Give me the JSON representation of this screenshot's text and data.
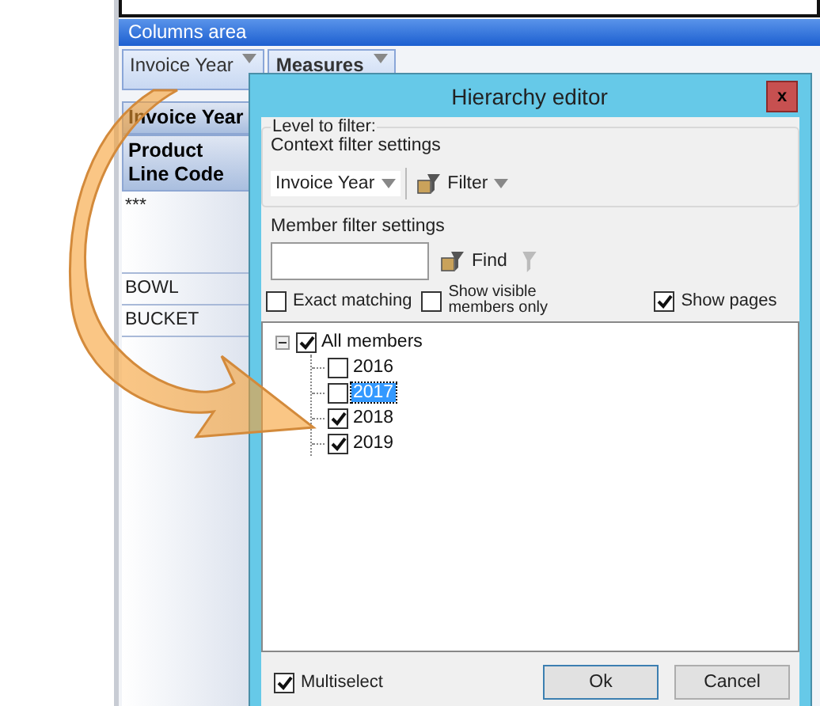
{
  "pivot": {
    "columns_area": {
      "title": "Columns area",
      "fields": [
        {
          "label": "Invoice Year"
        },
        {
          "label": "Measures"
        }
      ]
    },
    "row_headers": [
      "Invoice Year",
      "Product Line Code"
    ],
    "rows": [
      {
        "label": "***"
      },
      {
        "label": "BOWL"
      },
      {
        "label": "BUCKET"
      }
    ]
  },
  "dialog": {
    "title": "Hierarchy editor",
    "close": "x",
    "level_group": "Level to filter:",
    "context_label": "Context filter settings",
    "level_dropdown": "Invoice Year",
    "filter_button": "Filter",
    "member_label": "Member filter settings",
    "find_button": "Find",
    "clear_button": {
      "disabled": true
    },
    "options": [
      {
        "label": "Exact matching",
        "checked": false
      },
      {
        "label": "Show visible members only",
        "checked": false
      },
      {
        "label": "Show pages",
        "checked": true
      }
    ],
    "tree": [
      {
        "label": "All members",
        "checked": true,
        "selected": false,
        "expanded": true,
        "children": [
          {
            "label": "2016",
            "checked": false,
            "selected": false
          },
          {
            "label": "2017",
            "checked": false,
            "selected": true
          },
          {
            "label": "2018",
            "checked": true,
            "selected": false
          },
          {
            "label": "2019",
            "checked": true,
            "selected": false
          }
        ]
      }
    ],
    "multiselect": {
      "label": "Multiselect",
      "checked": true
    },
    "buttons": [
      "Ok",
      "Cancel"
    ]
  }
}
